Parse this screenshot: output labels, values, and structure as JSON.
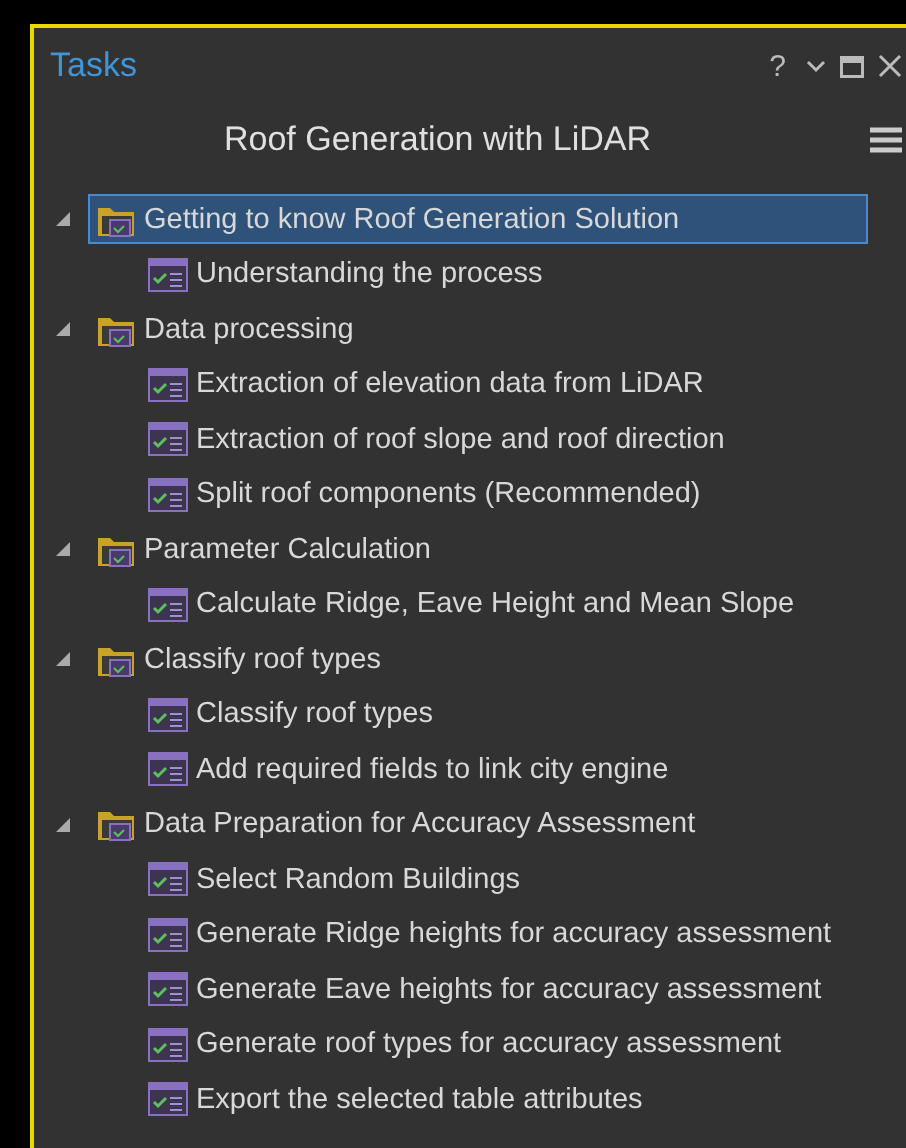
{
  "pane": {
    "title": "Tasks",
    "help": "?"
  },
  "task_title": "Roof Generation with LiDAR",
  "tree": [
    {
      "label": "Getting to know Roof Generation Solution",
      "expanded": true,
      "selected": true,
      "children": [
        {
          "label": "Understanding the process"
        }
      ]
    },
    {
      "label": "Data processing",
      "expanded": true,
      "selected": false,
      "children": [
        {
          "label": "Extraction of elevation data from LiDAR"
        },
        {
          "label": "Extraction of roof slope and roof direction"
        },
        {
          "label": "Split roof components (Recommended)"
        }
      ]
    },
    {
      "label": "Parameter Calculation",
      "expanded": true,
      "selected": false,
      "children": [
        {
          "label": "Calculate Ridge, Eave Height and Mean Slope"
        }
      ]
    },
    {
      "label": "Classify roof types",
      "expanded": true,
      "selected": false,
      "children": [
        {
          "label": "Classify roof types"
        },
        {
          "label": "Add required fields to link city engine"
        }
      ]
    },
    {
      "label": "Data Preparation for Accuracy Assessment",
      "expanded": true,
      "selected": false,
      "children": [
        {
          "label": "Select Random Buildings"
        },
        {
          "label": "Generate Ridge heights for accuracy assessment"
        },
        {
          "label": "Generate Eave heights for accuracy assessment"
        },
        {
          "label": "Generate roof types for accuracy assessment"
        },
        {
          "label": "Export the selected table attributes"
        }
      ]
    }
  ]
}
